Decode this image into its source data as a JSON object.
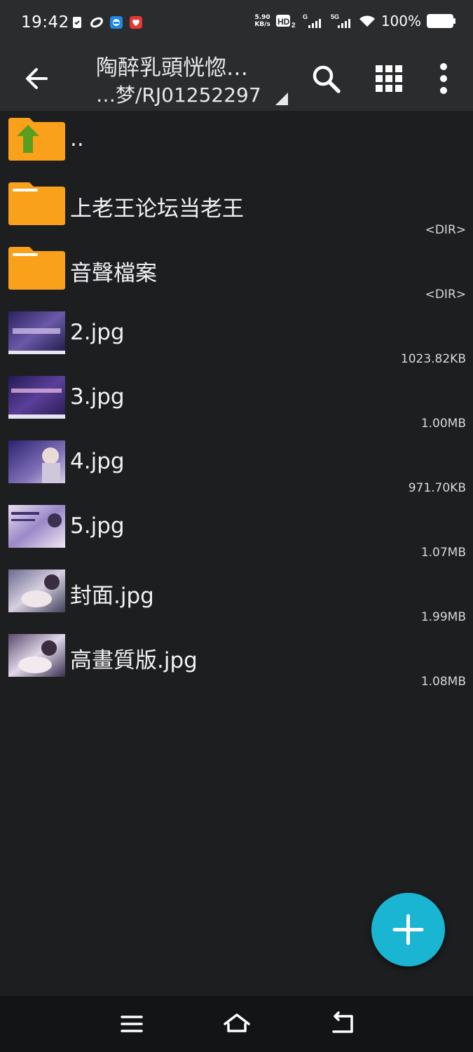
{
  "status_bar": {
    "time": "19:42",
    "net_speed_value": "5.90",
    "net_speed_unit": "KB/s",
    "hd_label": "HD",
    "hd_sub": "2",
    "signal1_label": "G",
    "signal2_label": "5G",
    "battery": "100%",
    "icons": [
      "sim-card-icon",
      "sync-icon",
      "messenger-icon",
      "app-icon",
      "hd-voice-icon",
      "cell-signal-icon",
      "cell-signal-5g-icon",
      "wifi-icon",
      "battery-icon"
    ]
  },
  "toolbar": {
    "title_line1": "陶醉乳頭恍惚…",
    "title_line2": "…梦/RJ01252297",
    "icons": [
      "back-arrow-icon",
      "search-icon",
      "grid-view-icon",
      "more-vert-icon"
    ]
  },
  "files": [
    {
      "name": "..",
      "meta": "",
      "kind": "parent"
    },
    {
      "name": "上老王论坛当老王",
      "meta": "<DIR>",
      "kind": "folder"
    },
    {
      "name": "音聲檔案",
      "meta": "<DIR>",
      "kind": "folder"
    },
    {
      "name": "2.jpg",
      "meta": "1023.82KB",
      "kind": "image"
    },
    {
      "name": "3.jpg",
      "meta": "1.00MB",
      "kind": "image"
    },
    {
      "name": "4.jpg",
      "meta": "971.70KB",
      "kind": "image"
    },
    {
      "name": "5.jpg",
      "meta": "1.07MB",
      "kind": "image"
    },
    {
      "name": "封面.jpg",
      "meta": "1.99MB",
      "kind": "image"
    },
    {
      "name": "高畫質版.jpg",
      "meta": "1.08MB",
      "kind": "image"
    }
  ],
  "fab": {
    "icon": "plus-icon"
  },
  "nav_bar": {
    "icons": [
      "menu-icon",
      "home-icon",
      "back-icon"
    ]
  },
  "colors": {
    "accent": "#19b5d2",
    "folder": "#f9a11b",
    "background": "#1d1e20",
    "toolbar": "#2b2c2e"
  }
}
